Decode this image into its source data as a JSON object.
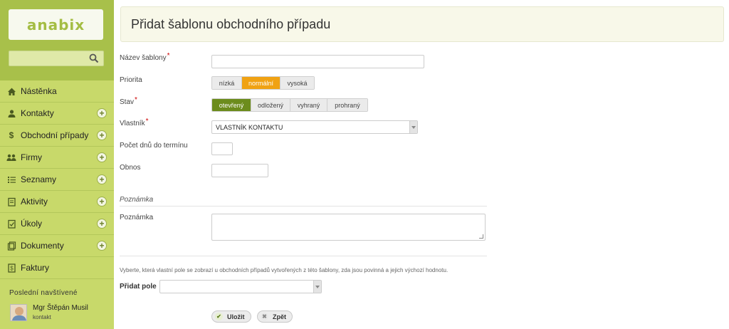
{
  "app": {
    "logo": "anabix"
  },
  "sidebar": {
    "search_placeholder": "",
    "items": [
      {
        "label": "Nástěnka",
        "icon": "home-icon",
        "has_add": false
      },
      {
        "label": "Kontakty",
        "icon": "contact-icon",
        "has_add": true
      },
      {
        "label": "Obchodní případy",
        "icon": "dollar-icon",
        "has_add": true
      },
      {
        "label": "Firmy",
        "icon": "company-icon",
        "has_add": true
      },
      {
        "label": "Seznamy",
        "icon": "list-icon",
        "has_add": true
      },
      {
        "label": "Aktivity",
        "icon": "activity-icon",
        "has_add": true
      },
      {
        "label": "Úkoly",
        "icon": "task-icon",
        "has_add": true
      },
      {
        "label": "Dokumenty",
        "icon": "document-icon",
        "has_add": true
      },
      {
        "label": "Faktury",
        "icon": "invoice-icon",
        "has_add": false
      }
    ],
    "recent_heading": "Poslední navštívené",
    "recent": {
      "name": "Mgr Štěpán Musil",
      "type": "kontakt"
    }
  },
  "page": {
    "title": "Přidat šablonu obchodního případu"
  },
  "form": {
    "name_label": "Název šablony",
    "name_value": "",
    "priority_label": "Priorita",
    "priority_options": [
      "nízká",
      "normální",
      "vysoká"
    ],
    "priority_selected": "normální",
    "state_label": "Stav",
    "state_options": [
      "otevřený",
      "odložený",
      "vyhraný",
      "prohraný"
    ],
    "state_selected": "otevřený",
    "owner_label": "Vlastník",
    "owner_value": "VLASTNÍK KONTAKTU",
    "days_label": "Počet dnů do termínu",
    "days_value": "",
    "revenue_label": "Obnos",
    "revenue_value": "",
    "note_section": "Poznámka",
    "note_label": "Poznámka",
    "note_value": "",
    "custom_hint": "Vyberte, která vlastní pole se zobrazí u obchodních případů vytvořených z této šablony, zda jsou povinná a jejich výchozí hodnotu.",
    "add_field_label": "Přidat pole",
    "add_field_value": "",
    "required_mark": "*"
  },
  "actions": {
    "save": "Uložit",
    "back": "Zpět"
  },
  "colors": {
    "sidebar": "#c8d96a",
    "accent_orange": "#f0a213",
    "accent_green": "#6c8c1c"
  }
}
